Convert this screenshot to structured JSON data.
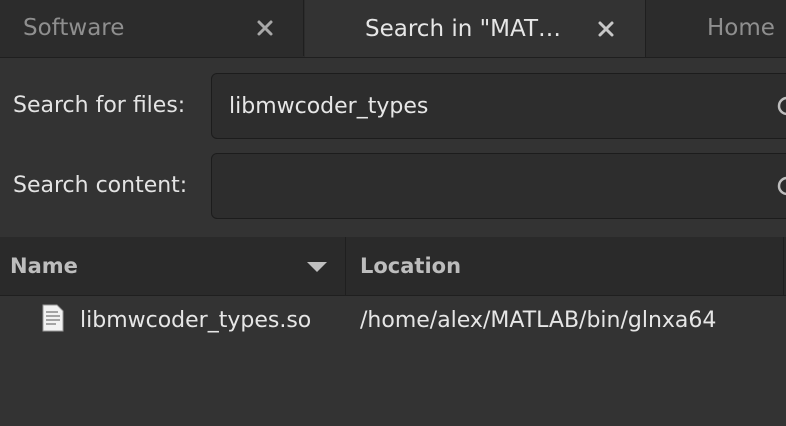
{
  "tabs": [
    {
      "label": "Software",
      "active": false,
      "closable": true
    },
    {
      "label": "Search in \"MAT…",
      "active": true,
      "closable": true
    },
    {
      "label": "Home",
      "active": false,
      "closable": false
    }
  ],
  "search": {
    "files_label": "Search for files:",
    "files_value": "libmwcoder_types",
    "content_label": "Search content:",
    "content_value": ""
  },
  "table": {
    "columns": [
      {
        "label": "Name",
        "sorted": "descending"
      },
      {
        "label": "Location"
      }
    ],
    "rows": [
      {
        "name": "libmwcoder_types.so",
        "location": "/home/alex/MATLAB/bin/glnxa64",
        "icon": "text-file-icon"
      }
    ]
  },
  "colors": {
    "background": "#333333",
    "tabbar": "#2c2c2c",
    "text": "#e6e6e6",
    "muted_text": "#8f8f8f"
  }
}
